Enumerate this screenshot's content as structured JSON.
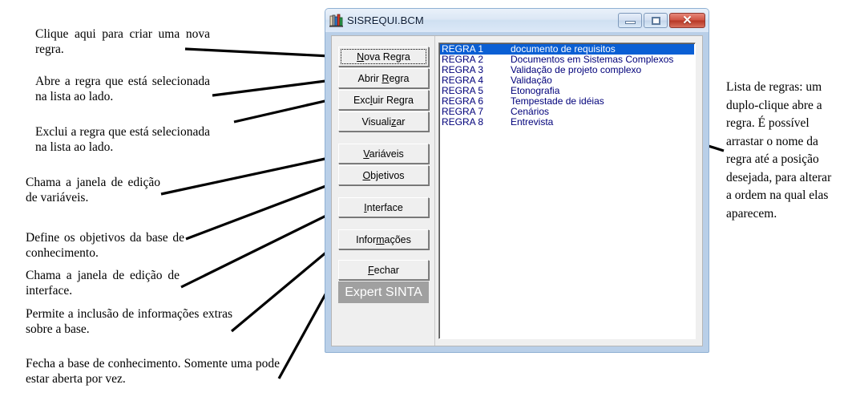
{
  "window": {
    "title": "SISREQUI.BCM",
    "icon": "knowledge-base-icon",
    "caption_buttons": {
      "minimize": "minimize",
      "maximize": "maximize",
      "close": "close"
    },
    "brand_label": "Expert SINTA",
    "buttons": [
      {
        "label": "Nova Regra",
        "mnemonic": "N",
        "focused": true,
        "group": 1
      },
      {
        "label": "Abrir Regra",
        "mnemonic": "R",
        "focused": false,
        "group": 1
      },
      {
        "label": "Excluir Regra",
        "mnemonic": "l",
        "focused": false,
        "group": 1
      },
      {
        "label": "Visualizar",
        "mnemonic": "z",
        "focused": false,
        "group": 1
      },
      {
        "label": "Variáveis",
        "mnemonic": "V",
        "focused": false,
        "group": 2
      },
      {
        "label": "Objetivos",
        "mnemonic": "O",
        "focused": false,
        "group": 2
      },
      {
        "label": "Interface",
        "mnemonic": "I",
        "focused": false,
        "group": 3
      },
      {
        "label": "Informações",
        "mnemonic": "m",
        "focused": false,
        "group": 4
      },
      {
        "label": "Fechar",
        "mnemonic": "F",
        "focused": false,
        "group": 5
      }
    ],
    "rules_list": {
      "selected_index": 0,
      "rows": [
        {
          "name": "REGRA 1",
          "desc": "documento de requisitos"
        },
        {
          "name": "REGRA 2",
          "desc": "Documentos em Sistemas Complexos"
        },
        {
          "name": "REGRA 3",
          "desc": "Validação de projeto complexo"
        },
        {
          "name": "REGRA 4",
          "desc": "Validação"
        },
        {
          "name": "REGRA 5",
          "desc": "Etonografia"
        },
        {
          "name": "REGRA 6",
          "desc": "Tempestade de idéias"
        },
        {
          "name": "REGRA 7",
          "desc": "Cenários"
        },
        {
          "name": "REGRA 8",
          "desc": "Entrevista"
        }
      ]
    }
  },
  "annotations": {
    "left": [
      {
        "id": "nova-regra",
        "text": "Clique aqui para criar uma nova regra."
      },
      {
        "id": "abrir-regra",
        "text": "Abre a regra que está selecionada na lista ao lado."
      },
      {
        "id": "excluir-regra",
        "text": "Exclui a regra que está selecionada na lista ao lado."
      },
      {
        "id": "variaveis",
        "text": "Chama a janela de edição de variáveis."
      },
      {
        "id": "objetivos",
        "text": "Define os objetivos da base de conhecimento."
      },
      {
        "id": "interface",
        "text": "Chama a janela de edição de interface."
      },
      {
        "id": "informacoes",
        "text": "Permite a inclusão de informações extras sobre a base."
      },
      {
        "id": "fechar",
        "text": "Fecha a base de conhecimento. Somente uma pode estar aberta por vez."
      }
    ],
    "right": [
      {
        "id": "lista-regras",
        "text": "Lista de regras: um duplo-clique abre a regra. É possível arrastar o nome da regra até a posição desejada, para alterar a ordem na qual elas aparecem."
      }
    ]
  },
  "colors": {
    "window_frame": "#b9cfe8",
    "client_bg": "#efefef",
    "selection": "#0a5fd4",
    "list_text": "#00007a",
    "brand_bg": "#a0a0a0",
    "close_button": "#b63625",
    "annotation_text": "#000000"
  }
}
